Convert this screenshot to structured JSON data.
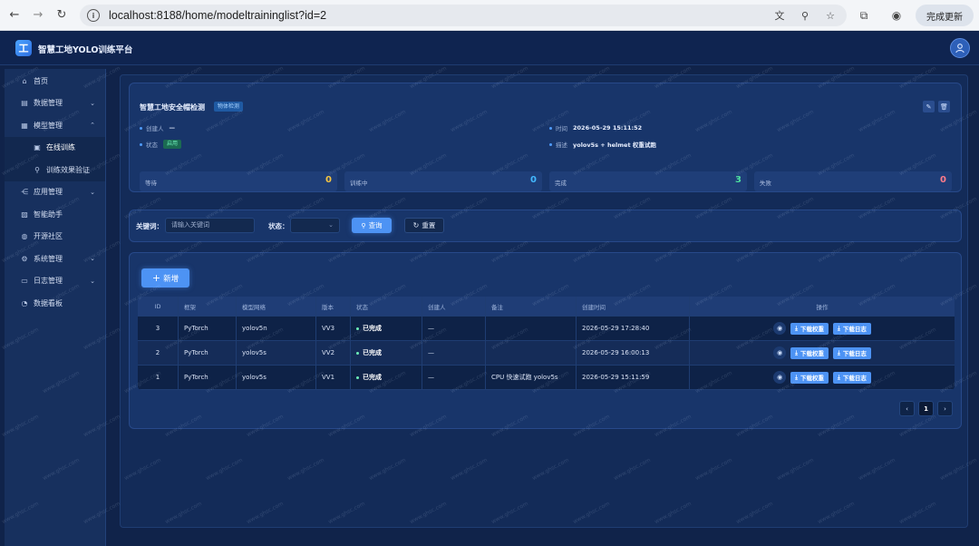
{
  "browser": {
    "back_icon": "arrow-left-icon",
    "forward_icon": "arrow-right-icon",
    "reload_icon": "reload-icon",
    "url": "localhost:8188/home/modeltraininglist?id=2",
    "update_label": "完成更新"
  },
  "app": {
    "logo_text": "工",
    "title": "智慧工地YOLO训练平台"
  },
  "sidebar": {
    "items": [
      {
        "label": "首页",
        "icon": "⌂"
      },
      {
        "label": "数据管理",
        "icon": "▤"
      },
      {
        "label": "模型管理",
        "icon": "▦"
      },
      {
        "label": "在线训练",
        "icon": "▣"
      },
      {
        "label": "训练效果验证",
        "icon": "⚲"
      },
      {
        "label": "应用管理",
        "icon": "⋲"
      },
      {
        "label": "智能助手",
        "icon": "▨"
      },
      {
        "label": "开源社区",
        "icon": "◍"
      },
      {
        "label": "系统管理",
        "icon": "⚙"
      },
      {
        "label": "日志管理",
        "icon": "▭"
      },
      {
        "label": "数据看板",
        "icon": "◔"
      }
    ]
  },
  "detail": {
    "title": "智慧工地安全帽检测",
    "type_tag": "物体检测",
    "creator_label": "创建人",
    "creator_value": "—",
    "status_label": "状态",
    "status_value": "启用",
    "time_label": "时间",
    "time_value": "2026-05-29 15:11:52",
    "desc_label": "描述",
    "desc_value": "yolov5s + helmet 权重试跑"
  },
  "stats": [
    {
      "label": "等待",
      "value": "0",
      "color": "#f5c542"
    },
    {
      "label": "训练中",
      "value": "0",
      "color": "#43b8ff"
    },
    {
      "label": "完成",
      "value": "3",
      "color": "#4ee0a0"
    },
    {
      "label": "失败",
      "value": "0",
      "color": "#ff7b8a"
    }
  ],
  "filter": {
    "keyword_label": "关键词：",
    "keyword_placeholder": "请输入关键词",
    "status_label": "状态：",
    "search_label": "查询",
    "reset_label": "重置"
  },
  "toolbar": {
    "add_label": "新增"
  },
  "table": {
    "headers": [
      "ID",
      "框架",
      "模型网络",
      "版本",
      "状态",
      "创建人",
      "备注",
      "创建时间",
      "操作"
    ],
    "rows": [
      {
        "id": "3",
        "framework": "PyTorch",
        "network": "yolov5n",
        "version": "VV3",
        "status": "已完成",
        "creator": "—",
        "note": "",
        "time": "2026-05-29 17:28:40"
      },
      {
        "id": "2",
        "framework": "PyTorch",
        "network": "yolov5s",
        "version": "VV2",
        "status": "已完成",
        "creator": "—",
        "note": "",
        "time": "2026-05-29 16:00:13"
      },
      {
        "id": "1",
        "framework": "PyTorch",
        "network": "yolov5s",
        "version": "VV1",
        "status": "已完成",
        "creator": "—",
        "note": "CPU 快速试跑 yolov5s",
        "time": "2026-05-29 15:11:59"
      }
    ],
    "download_weights_label": "下载权重",
    "download_log_label": "下载日志"
  },
  "pagination": {
    "prev": "‹",
    "current": "1",
    "next": "›"
  },
  "watermark_text": "www.ghsc.com"
}
